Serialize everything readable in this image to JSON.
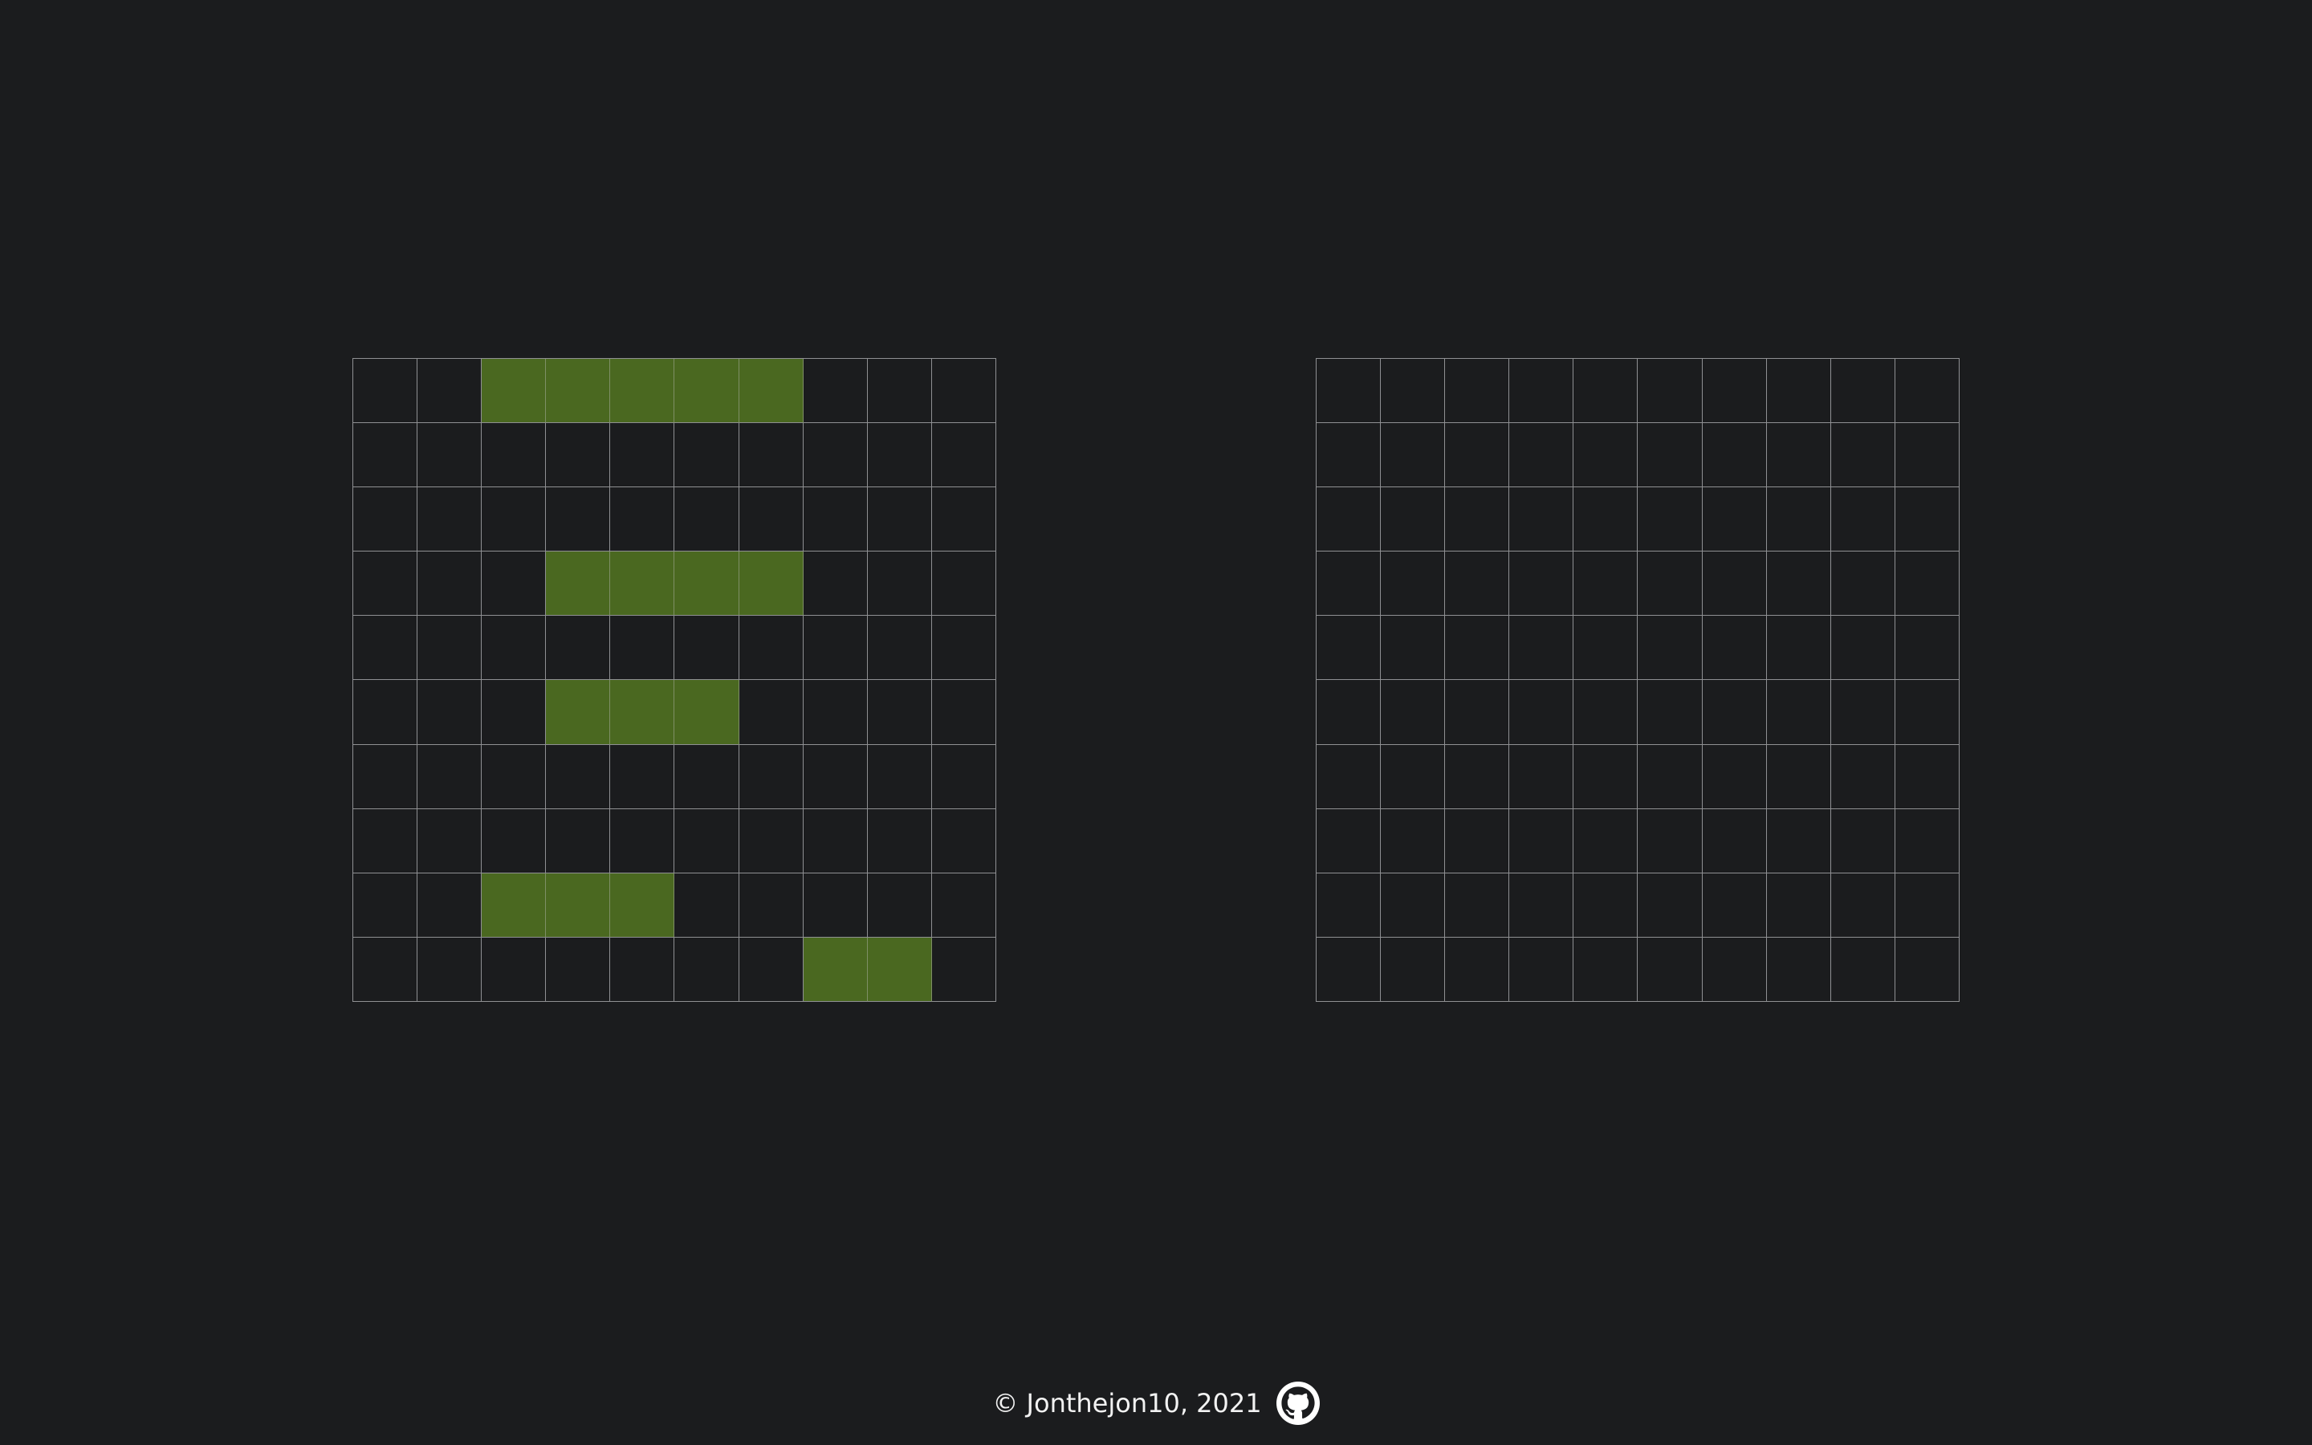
{
  "boards": {
    "size": 10,
    "player": {
      "ships": [
        {
          "row": 0,
          "col": 2,
          "length": 5,
          "orientation": "horizontal"
        },
        {
          "row": 3,
          "col": 3,
          "length": 4,
          "orientation": "horizontal"
        },
        {
          "row": 5,
          "col": 3,
          "length": 3,
          "orientation": "horizontal"
        },
        {
          "row": 8,
          "col": 2,
          "length": 3,
          "orientation": "horizontal"
        },
        {
          "row": 9,
          "col": 7,
          "length": 2,
          "orientation": "horizontal"
        }
      ]
    },
    "enemy": {
      "ships": []
    }
  },
  "colors": {
    "background": "#1b1c1e",
    "grid_line": "#8f9093",
    "ship": "#4a6820",
    "text": "#f2f2f2"
  },
  "footer": {
    "copyright": "© Jonthejon10, 2021",
    "link_icon": "github-icon"
  }
}
